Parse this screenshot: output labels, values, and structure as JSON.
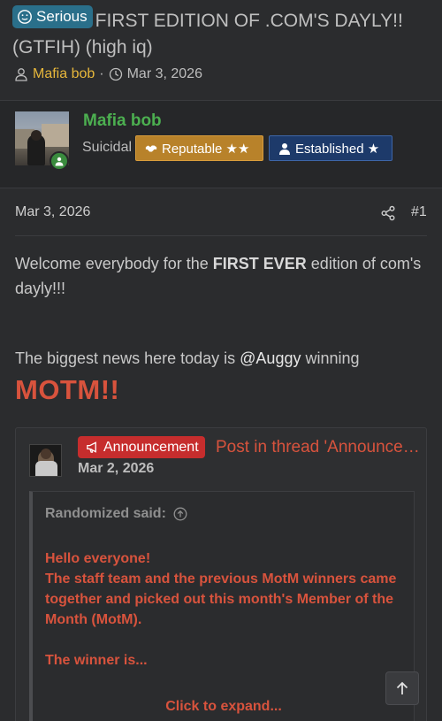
{
  "thread": {
    "prefix": "Serious",
    "title": "FIRST EDITION OF .COM'S DAYLY!! (GTFIH) (high iq)",
    "author": "Mafia bob",
    "separator": "·",
    "date": "Mar 3, 2026"
  },
  "user": {
    "name": "Mafia bob",
    "title": "Suicidal",
    "banners": [
      {
        "label": "Reputable ★★",
        "color": "#b8822a",
        "icon": "handshake-icon"
      },
      {
        "label": "Established ★",
        "color": "#1d3a6a",
        "icon": "user-icon"
      }
    ],
    "status_color": "#3a8b3e"
  },
  "post": {
    "date": "Mar 3, 2026",
    "number": "#1",
    "p1_before": "Welcome everybody for the ",
    "p1_bold": "FIRST EVER",
    "p1_after": " edition of com's dayly!!!",
    "p2_before": "The biggest news here today is ",
    "mention": "@Auggy",
    "p2_after": " winning",
    "motm": "MOTM!!"
  },
  "embed": {
    "badge": "Announcement",
    "thread_title": "Post in thread 'Announcement'",
    "date": "Mar 2, 2026",
    "quote_author": "Randomized said:",
    "quote_lines": [
      "Hello everyone!",
      "The staff team and the previous MotM winners came together and picked out this month's Member of the Month (MotM).",
      "The winner is..."
    ],
    "expand_label": "Click to expand..."
  },
  "colors": {
    "background": "#2b2c2e",
    "accent_red": "#d8533d",
    "author_gold": "#e7b73b",
    "username_green": "#4caf50",
    "prefix_blue": "#2a6f8a"
  }
}
